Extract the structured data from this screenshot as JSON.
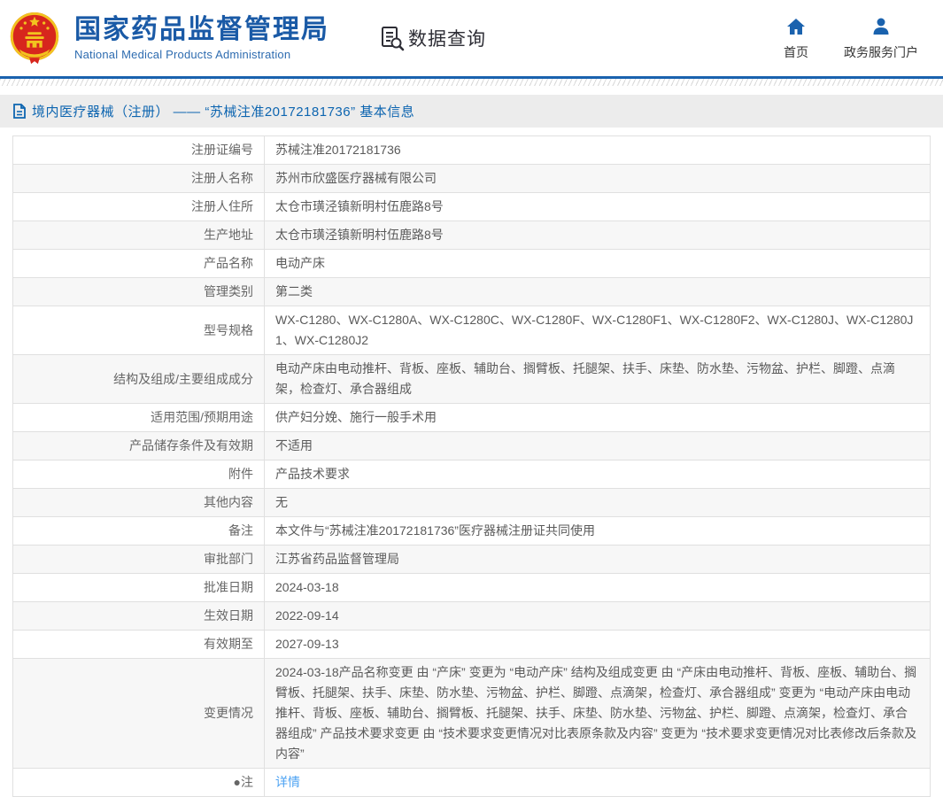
{
  "header": {
    "title": "国家药品监督管理局",
    "subtitle": "National Medical Products Administration",
    "data_query_label": "数据查询",
    "nav": [
      {
        "icon": "home-icon",
        "label": "首页"
      },
      {
        "icon": "person-icon",
        "label": "政务服务门户"
      }
    ]
  },
  "breadcrumb": {
    "icon": "document-icon",
    "text": "境内医疗器械（注册） —— “苏械注准20172181736” 基本信息"
  },
  "colors": {
    "brand_blue": "#1a5aa6",
    "rule_blue": "#1a62ae",
    "breadcrumb_bg": "#ececec",
    "breadcrumb_text": "#0d65b0",
    "row_alt_bg": "#f7f7f7",
    "table_border": "#e0e0e0",
    "link_blue": "#4da3f3",
    "emblem_red": "#d7261d",
    "emblem_gold": "#f2c31f"
  },
  "table": {
    "rows": [
      {
        "label": "注册证编号",
        "value": "苏械注准20172181736"
      },
      {
        "label": "注册人名称",
        "value": "苏州市欣盛医疗器械有限公司"
      },
      {
        "label": "注册人住所",
        "value": "太仓市璜泾镇新明村伍鹿路8号"
      },
      {
        "label": "生产地址",
        "value": "太仓市璜泾镇新明村伍鹿路8号"
      },
      {
        "label": "产品名称",
        "value": "电动产床"
      },
      {
        "label": "管理类别",
        "value": "第二类"
      },
      {
        "label": "型号规格",
        "value": "WX-C1280、WX-C1280A、WX-C1280C、WX-C1280F、WX-C1280F1、WX-C1280F2、WX-C1280J、WX-C1280J1、WX-C1280J2"
      },
      {
        "label": "结构及组成/主要组成成分",
        "value": "电动产床由电动推杆、背板、座板、辅助台、搁臂板、托腿架、扶手、床垫、防水垫、污物盆、护栏、脚蹬、点滴架，检查灯、承合器组成"
      },
      {
        "label": "适用范围/预期用途",
        "value": "供产妇分娩、施行一般手术用"
      },
      {
        "label": "产品储存条件及有效期",
        "value": "不适用"
      },
      {
        "label": "附件",
        "value": "产品技术要求"
      },
      {
        "label": "其他内容",
        "value": "无"
      },
      {
        "label": "备注",
        "value": "本文件与“苏械注准20172181736”医疗器械注册证共同使用"
      },
      {
        "label": "审批部门",
        "value": "江苏省药品监督管理局"
      },
      {
        "label": "批准日期",
        "value": "2024-03-18"
      },
      {
        "label": "生效日期",
        "value": "2022-09-14"
      },
      {
        "label": "有效期至",
        "value": "2027-09-13"
      },
      {
        "label": "变更情况",
        "value": "2024-03-18产品名称变更 由 “产床” 变更为 “电动产床” 结构及组成变更 由 “产床由电动推杆、背板、座板、辅助台、搁臂板、托腿架、扶手、床垫、防水垫、污物盆、护栏、脚蹬、点滴架，检查灯、承合器组成” 变更为 “电动产床由电动推杆、背板、座板、辅助台、搁臂板、托腿架、扶手、床垫、防水垫、污物盆、护栏、脚蹬、点滴架，检查灯、承合器组成” 产品技术要求变更 由 “技术要求变更情况对比表原条款及内容” 变更为 “技术要求变更情况对比表修改后条款及内容”"
      },
      {
        "label": "●注",
        "value": "详情"
      }
    ]
  }
}
